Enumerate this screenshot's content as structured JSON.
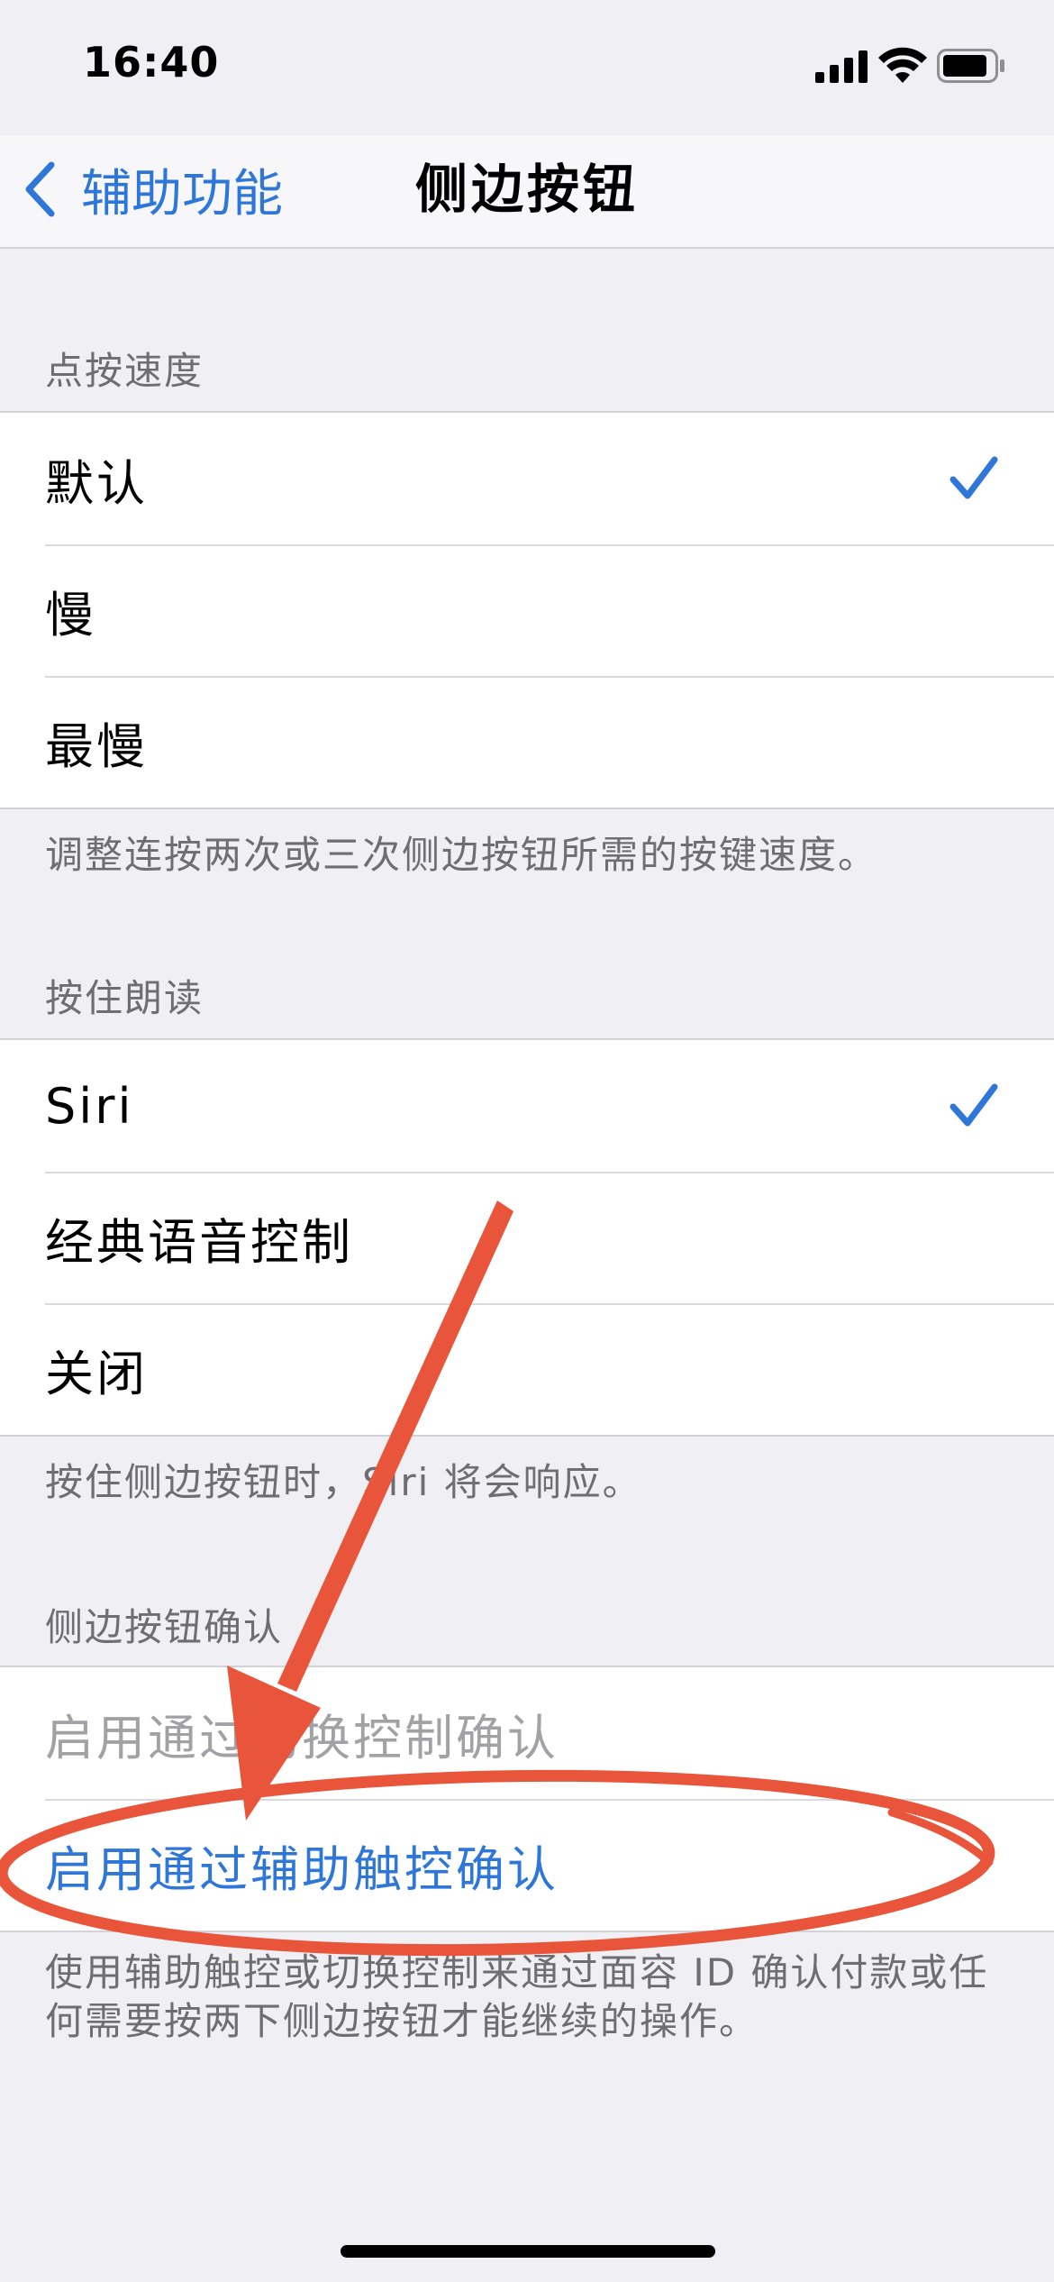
{
  "status_bar": {
    "time": "16:40"
  },
  "nav": {
    "back_label": "辅助功能",
    "title": "侧边按钮"
  },
  "sections": {
    "click_speed": {
      "header": "点按速度",
      "items": [
        {
          "label": "默认",
          "checked": true
        },
        {
          "label": "慢"
        },
        {
          "label": "最慢"
        }
      ],
      "footer": "调整连按两次或三次侧边按钮所需的按键速度。"
    },
    "press_hold": {
      "header": "按住朗读",
      "items": [
        {
          "label": "Siri",
          "checked": true
        },
        {
          "label": "经典语音控制"
        },
        {
          "label": "关闭"
        }
      ],
      "footer": "按住侧边按钮时，Siri 将会响应。"
    },
    "confirm": {
      "header": "侧边按钮确认",
      "items": [
        {
          "label": "启用通过切换控制确认",
          "state": "disabled"
        },
        {
          "label": "启用通过辅助触控确认",
          "state": "link"
        }
      ],
      "footer": "使用辅助触控或切换控制来通过面容 ID 确认付款或任何需要按两下侧边按钮才能继续的操作。"
    }
  },
  "colors": {
    "accent": "#2f76d9",
    "annotation": "#e8553a",
    "background": "#efeff4",
    "secondary_text": "#6d6d72"
  },
  "icons": {
    "back": "chevron-left-icon",
    "check": "checkmark-icon",
    "signal": "cellular-signal-icon",
    "wifi": "wifi-icon",
    "battery": "battery-icon"
  }
}
